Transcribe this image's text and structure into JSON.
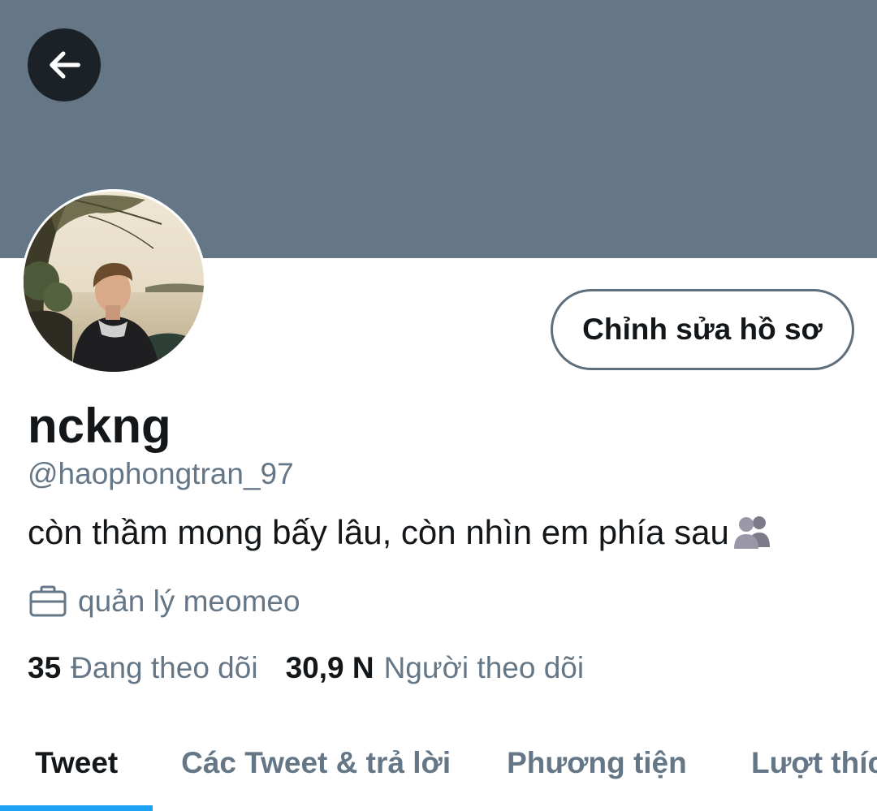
{
  "header": {
    "back_icon": "arrow-left-icon",
    "banner_color": "#657786"
  },
  "profile": {
    "avatar": "profile-photo",
    "edit_button_label": "Chỉnh sửa hồ sơ",
    "display_name": "nckng",
    "handle": "@haophongtran_97",
    "bio": "còn thầm mong bấy lâu, còn nhìn em phía sau",
    "bio_emoji": "busts-in-silhouette-emoji",
    "job_icon": "briefcase-icon",
    "job": "quản lý meomeo"
  },
  "stats": {
    "following_count": "35",
    "following_label": "Đang theo dõi",
    "followers_count": "30,9 N",
    "followers_label": "Người theo dõi"
  },
  "tabs": [
    {
      "label": "Tweet",
      "active": true
    },
    {
      "label": "Các Tweet & trả lời",
      "active": false
    },
    {
      "label": "Phương tiện",
      "active": false
    },
    {
      "label": "Lượt thích",
      "active": false
    }
  ],
  "colors": {
    "accent": "#1da1f2",
    "text_primary": "#14171a",
    "text_secondary": "#657786"
  }
}
